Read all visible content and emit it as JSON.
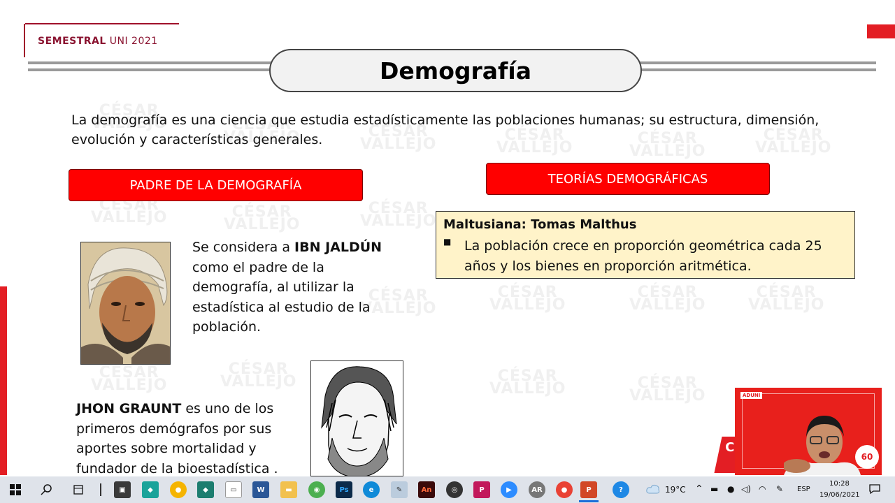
{
  "header": {
    "brand_bold": "SEMESTRAL",
    "brand_rest": " UNI 2021",
    "title": "Demografía"
  },
  "intro": "La demografía es una ciencia que estudia estadísticamente las poblaciones humanas; su estructura, dimensión, evolución y características generales.",
  "left": {
    "heading": "PADRE DE LA DEMOGRAFÍA",
    "ibn_pre": "Se considera a ",
    "ibn_name": "IBN JALDÚN",
    "ibn_post": " como el padre de la demografía, al utilizar la estadística al estudio de la población.",
    "graunt_name": "JHON GRAUNT",
    "graunt_post": " es uno de los primeros demógrafos por sus aportes sobre mortalidad y fundador de la bioestadística ."
  },
  "right": {
    "heading": "TEORÍAS DEMOGRÁFICAS",
    "theory_title": "Maltusiana: Tomas Malthus",
    "theory_bullet": "■",
    "theory_text": "La población crece en proporción geométrica cada 25 años y los bienes en proporción aritmética."
  },
  "webcam": {
    "logo": "ADUNI",
    "badge": "60",
    "overlay_text": "CÉ V"
  },
  "taskbar": {
    "icons": [
      "windows-start",
      "search",
      "task-view",
      "separator",
      "store",
      "app-green",
      "chrome",
      "app-dark",
      "notepad",
      "word",
      "explorer",
      "maps",
      "photoshop",
      "edge",
      "app-misc",
      "animate",
      "media-player",
      "app-purple",
      "zoom",
      "app-rec",
      "chrome-2",
      "powerpoint",
      "help"
    ],
    "weather": "19°C",
    "language": "ESP",
    "time": "10:28",
    "date": "19/06/2021"
  }
}
